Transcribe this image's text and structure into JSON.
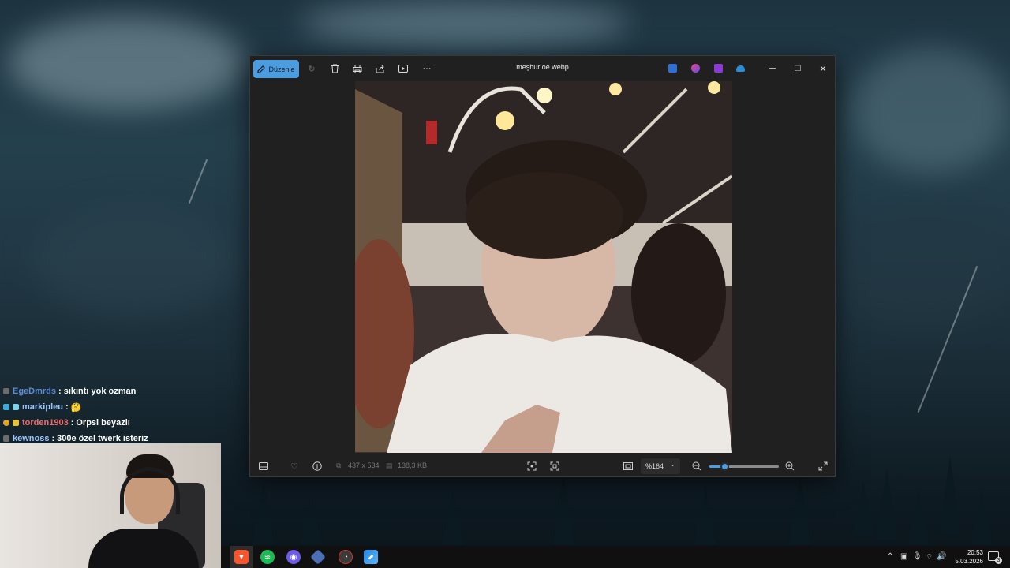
{
  "chat": [
    {
      "user": "EgeDmrds",
      "sep": ":",
      "message": "sıkıntı yok ozman",
      "color": "#5b8bd6",
      "badge": "#6b6b6b"
    },
    {
      "user": "markipleu",
      "sep": ":",
      "message": "🤔",
      "color": "#9ec7ff",
      "badge": "#3fa9d8"
    },
    {
      "user": "torden1903",
      "sep": ":",
      "message": "Orpsi beyazlı",
      "color": "#f06c6c",
      "badge": "#e0a62a"
    },
    {
      "user": "kewnoss",
      "sep": ":",
      "message": "300e özel twerk isteriz",
      "color": "#9ec7ff",
      "badge": "#6b6b6b"
    }
  ],
  "photos_window": {
    "title": "meşhur oe.webp",
    "edit_label": "Düzenle",
    "dimensions": "437 x 534",
    "file_size": "138,3 KB",
    "zoom_label": "%164",
    "zoom_level_fraction": 0.22,
    "accent": "#4c9ddf",
    "toolbar_icons": [
      "rotate-icon",
      "delete-icon",
      "print-icon",
      "share-icon",
      "slideshow-icon",
      "more-icon"
    ],
    "window_controls": {
      "minimize": "─",
      "maximize": "☐",
      "close": "✕"
    }
  },
  "taskbar": {
    "time": "20:53",
    "date": "5.03.2026",
    "notification_count": "3",
    "apps": [
      "brave-icon",
      "spotify-icon",
      "discord-icon",
      "tool-icon",
      "obs-icon",
      "photos-icon"
    ]
  }
}
